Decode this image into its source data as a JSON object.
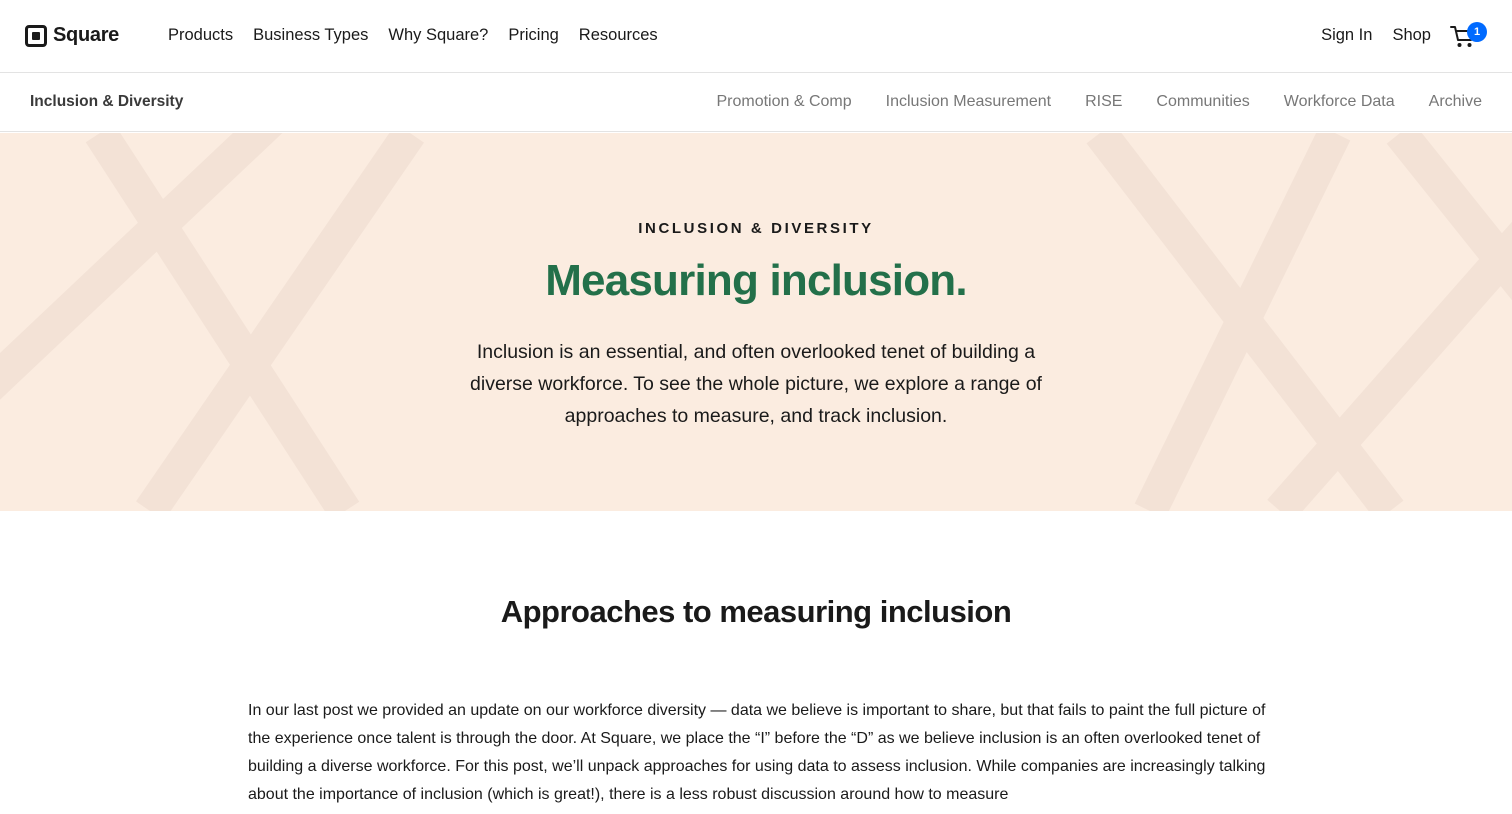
{
  "header": {
    "brand": "Square",
    "primary_nav": [
      "Products",
      "Business Types",
      "Why Square?",
      "Pricing",
      "Resources"
    ],
    "sign_in": "Sign In",
    "shop": "Shop",
    "cart_count": "1"
  },
  "subnav": {
    "title": "Inclusion & Diversity",
    "links": [
      "Promotion & Comp",
      "Inclusion Measurement",
      "RISE",
      "Communities",
      "Workforce Data",
      "Archive"
    ]
  },
  "hero": {
    "eyebrow": "INCLUSION & DIVERSITY",
    "title": "Measuring inclusion.",
    "text": "Inclusion is an essential, and often overlooked tenet of building a diverse workforce. To see the whole picture, we explore a range of approaches to measure, and track inclusion."
  },
  "main": {
    "section_title": "Approaches to measuring inclusion",
    "body": "In our last post we provided an update on our workforce diversity — data we believe is important to share, but that fails to paint the full picture of the experience once talent is through the door. At Square, we place the “I” before the “D” as we believe inclusion is an often overlooked tenet of building a diverse workforce. For this post, we’ll unpack approaches for using data to assess inclusion. While companies are increasingly talking about the importance of inclusion (which is great!), there is a less robust discussion around how to measure"
  },
  "colors": {
    "hero_bg": "#fbece0",
    "hero_title": "#23704a",
    "cart_badge": "#006aff"
  }
}
